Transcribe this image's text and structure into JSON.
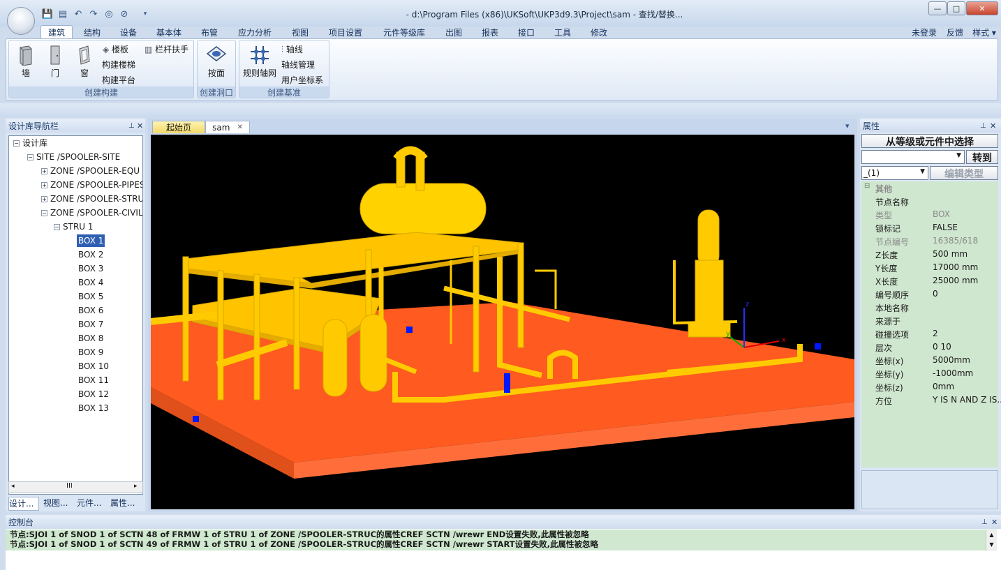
{
  "window": {
    "title": "- d:\\Program Files (x86)\\UKSoft\\UKP3d9.3\\Project\\sam - 查找/替换...",
    "min": "—",
    "max": "□",
    "close": "✕"
  },
  "qat": [
    "💾",
    "▤",
    "↶",
    "↷",
    "◎",
    "⊘",
    "▾"
  ],
  "tabs": [
    "建筑",
    "结构",
    "设备",
    "基本体",
    "布管",
    "应力分析",
    "视图",
    "项目设置",
    "元件等级库",
    "出图",
    "报表",
    "接口",
    "工具",
    "修改"
  ],
  "right_menu": {
    "login": "未登录",
    "feedback": "反馈",
    "style": "样式 ▾"
  },
  "ribbon": {
    "g1": {
      "caption": "创建构建",
      "wall": "墙",
      "door": "门",
      "window": "窗",
      "slab": "楼板",
      "stairs": "构建楼梯",
      "platform": "构建平台",
      "railing": "栏杆扶手"
    },
    "g2": {
      "caption": "创建洞口",
      "face": "按面"
    },
    "g3": {
      "caption": "创建基准",
      "grid": "规则轴网",
      "axis": "轴线",
      "axis_mgr": "轴线管理",
      "ucs": "用户坐标系"
    }
  },
  "left_panel": {
    "title": "设计库导航栏",
    "pin": "⊥",
    "close": "✕",
    "tree": {
      "root": "设计库",
      "site": "SITE /SPOOLER-SITE",
      "zones": [
        "ZONE /SPOOLER-EQU",
        "ZONE /SPOOLER-PIPES",
        "ZONE /SPOOLER-STRU",
        "ZONE /SPOOLER-CIVIL"
      ],
      "stru": "STRU 1",
      "boxes": [
        "BOX 1",
        "BOX 2",
        "BOX 3",
        "BOX 4",
        "BOX 5",
        "BOX 6",
        "BOX 7",
        "BOX 8",
        "BOX 9",
        "BOX 10",
        "BOX 11",
        "BOX 12",
        "BOX 13"
      ]
    },
    "scroll_mid": "III",
    "bottom_tabs": [
      "设计...",
      "视图...",
      "元件...",
      "属性..."
    ]
  },
  "doc": {
    "tabs": [
      "起始页",
      "sam"
    ],
    "tab_close": "✕",
    "dropdown": "▾"
  },
  "axes": {
    "x": "x",
    "y": "y",
    "z": "z"
  },
  "right_panel": {
    "title": "属性",
    "pin": "⊥",
    "close": "✕",
    "select_btn": "从等级或元件中选择",
    "goto_btn": "转到",
    "combo2": "_(1)",
    "edit_btn": "编辑类型",
    "category": "其他",
    "props": [
      {
        "k": "节点名称",
        "v": "",
        "grey": false
      },
      {
        "k": "类型",
        "v": "BOX",
        "grey": true
      },
      {
        "k": "锁标记",
        "v": "FALSE",
        "grey": false
      },
      {
        "k": "节点编号",
        "v": "16385/618",
        "grey": true
      },
      {
        "k": "Z长度",
        "v": "500 mm",
        "grey": false
      },
      {
        "k": "Y长度",
        "v": "17000 mm",
        "grey": false
      },
      {
        "k": "X长度",
        "v": "25000 mm",
        "grey": false
      },
      {
        "k": "编号顺序",
        "v": "0",
        "grey": false
      },
      {
        "k": "本地名称",
        "v": "",
        "grey": false
      },
      {
        "k": "来源于",
        "v": "",
        "grey": false
      },
      {
        "k": "碰撞选项",
        "v": "2",
        "grey": false
      },
      {
        "k": "层次",
        "v": "0 10",
        "grey": false
      },
      {
        "k": "坐标(x)",
        "v": " 5000mm",
        "grey": false
      },
      {
        "k": "坐标(y)",
        "v": " -1000mm",
        "grey": false
      },
      {
        "k": "坐标(z)",
        "v": " 0mm",
        "grey": false
      },
      {
        "k": "方位",
        "v": "Y IS N AND Z IS...",
        "grey": false
      }
    ]
  },
  "console": {
    "title": "控制台",
    "pin": "⊥",
    "close": "✕",
    "lines": [
      "节点:SJOI 1 of SNOD 1 of SCTN 48 of FRMW 1 of STRU 1 of ZONE /SPOOLER-STRUC的属性CREF SCTN /wrewr  END设置失败,此属性被忽略",
      "节点:SJOI 1 of SNOD 1 of SCTN 49 of FRMW 1 of STRU 1 of ZONE /SPOOLER-STRUC的属性CREF SCTN /wrewr  START设置失败,此属性被忽略"
    ]
  },
  "colors": {
    "floor": "#ff5a1f",
    "floor_side": "#ff6e3a",
    "structure": "#ffd200",
    "selection": "#0018ff"
  }
}
